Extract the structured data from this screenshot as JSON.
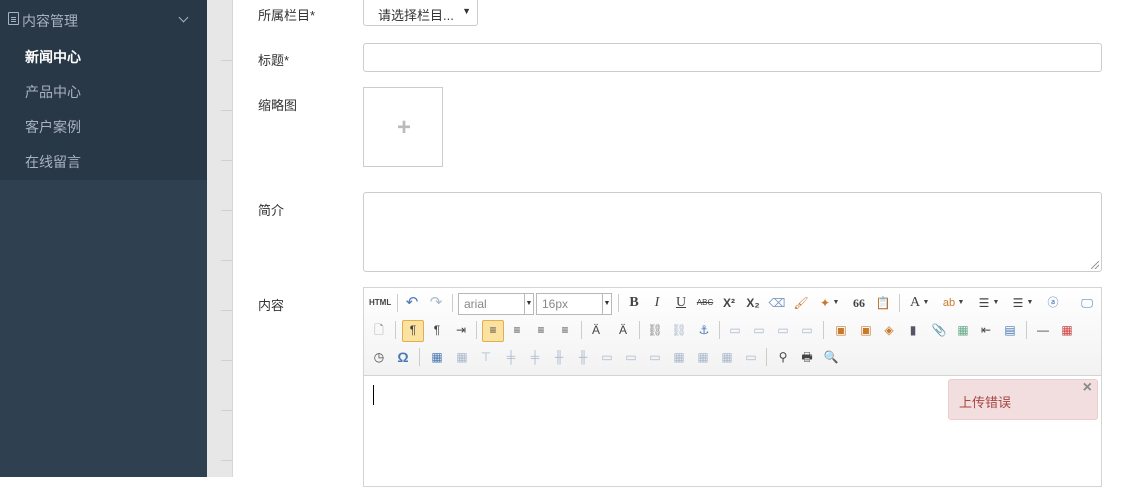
{
  "sidebar": {
    "group_title": "内容管理",
    "items": [
      {
        "label": "新闻中心",
        "active": true
      },
      {
        "label": "产品中心",
        "active": false
      },
      {
        "label": "客户案例",
        "active": false
      },
      {
        "label": "在线留言",
        "active": false
      }
    ]
  },
  "form": {
    "category_label": "所属栏目*",
    "category_value": "请选择栏目...",
    "title_label": "标题*",
    "title_value": "",
    "thumbnail_label": "缩略图",
    "thumbnail_add": "+",
    "summary_label": "简介",
    "summary_value": "",
    "content_label": "内容"
  },
  "editor": {
    "html_button": "HTML",
    "font_family": "arial",
    "font_size": "16px",
    "bold": "B",
    "italic": "I",
    "underline": "U",
    "strike": "ABC",
    "superscript": "X²",
    "subscript": "X₂",
    "quote": "66",
    "font_color": "A",
    "special_char": "Ω"
  },
  "notification": {
    "message": "上传错误",
    "close": "×"
  },
  "colors": {
    "sidebar_bg": "#2f4050",
    "sidebar_group_bg": "#293846",
    "sidebar_text": "#a7b1c2",
    "error_bg": "#f2dede",
    "error_text": "#a94442"
  }
}
